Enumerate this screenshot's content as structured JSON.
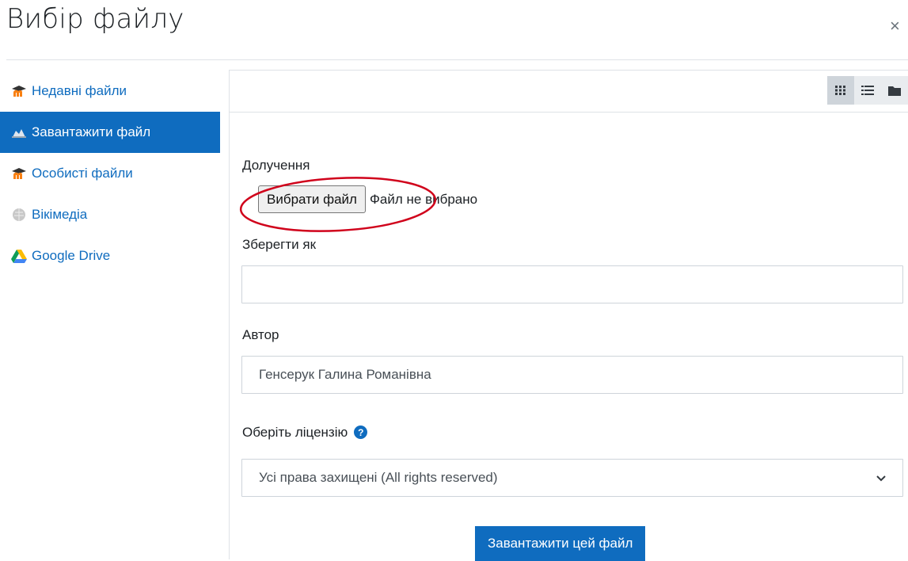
{
  "dialog": {
    "title": "Вибір файлу",
    "close_symbol": "×"
  },
  "sidebar": {
    "items": [
      {
        "label": "Недавні файли",
        "icon": "moodle-icon",
        "active": false
      },
      {
        "label": "Завантажити файл",
        "icon": "upload-icon",
        "active": true
      },
      {
        "label": "Особисті файли",
        "icon": "moodle-icon",
        "active": false
      },
      {
        "label": "Вікімедіа",
        "icon": "wikimedia-icon",
        "active": false
      },
      {
        "label": "Google Drive",
        "icon": "google-drive-icon",
        "active": false
      }
    ]
  },
  "toolbar": {
    "views": [
      "grid-view-icon",
      "list-view-icon",
      "folder-view-icon"
    ]
  },
  "form": {
    "attachment_label": "Долучення",
    "choose_file_button": "Вибрати файл",
    "file_status": "Файл не вибрано",
    "save_as_label": "Зберегти як",
    "save_as_value": "",
    "author_label": "Автор",
    "author_value": "Генсерук Галина Романівна",
    "license_label": "Оберіть ліцензію",
    "license_help_symbol": "?",
    "license_selected": "Усі права захищені (All rights reserved)",
    "upload_button": "Завантажити цей файл"
  },
  "colors": {
    "accent": "#0f6cbf",
    "annotation": "#d0021b"
  }
}
